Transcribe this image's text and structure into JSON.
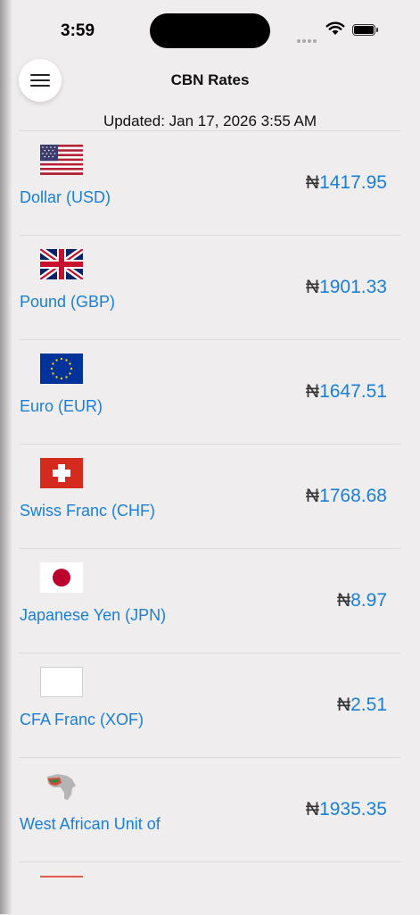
{
  "status_bar": {
    "time": "3:59"
  },
  "header": {
    "title": "CBN Rates",
    "updated": "Updated: Jan 17, 2026 3:55 AM"
  },
  "currency_symbol": "₦",
  "rates": [
    {
      "name": "Dollar (USD)",
      "value": "1417.95",
      "flag": "us-flag-icon"
    },
    {
      "name": "Pound (GBP)",
      "value": "1901.33",
      "flag": "uk-flag-icon"
    },
    {
      "name": "Euro (EUR)",
      "value": "1647.51",
      "flag": "eu-flag-icon"
    },
    {
      "name": "Swiss Franc (CHF)",
      "value": "1768.68",
      "flag": "swiss-flag-icon"
    },
    {
      "name": "Japanese Yen (JPN)",
      "value": "8.97",
      "flag": "japan-flag-icon"
    },
    {
      "name": "CFA Franc (XOF)",
      "value": "2.51",
      "flag": "blank-flag-icon"
    },
    {
      "name": "West African Unit of",
      "value": "1935.35",
      "flag": "africa-map-icon"
    }
  ],
  "colors": {
    "accent": "#1a7fd6",
    "background": "#efedee"
  }
}
